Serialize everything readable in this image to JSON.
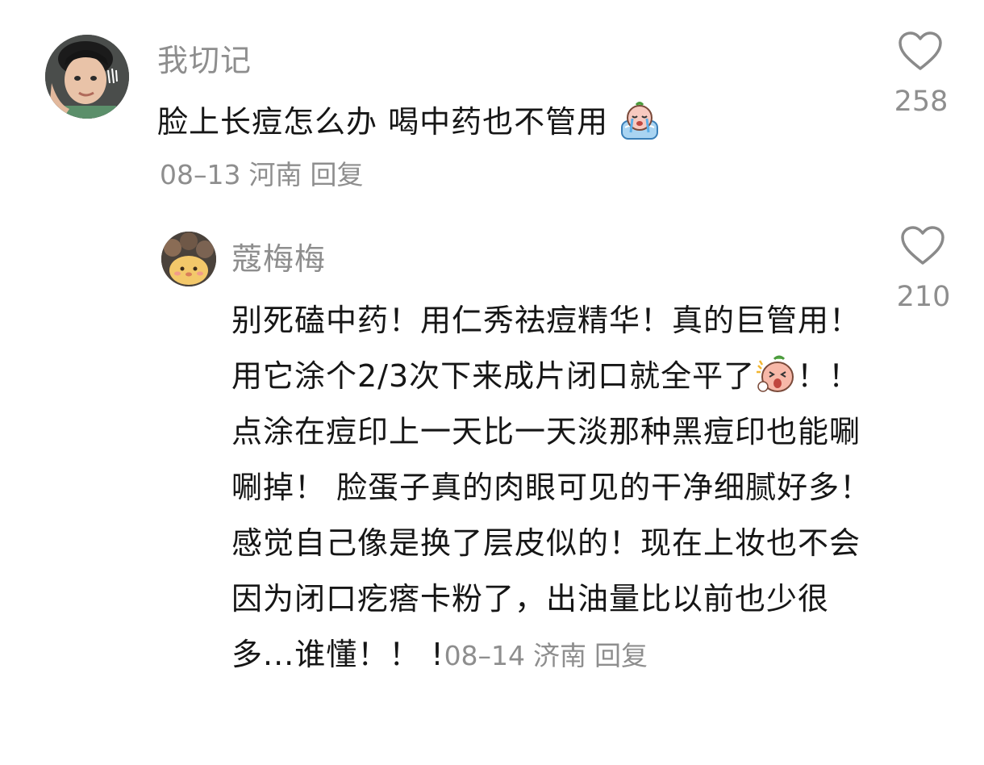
{
  "comments": [
    {
      "username": "我切记",
      "text": "脸上长痘怎么办 喝中药也不管用",
      "sticker": "crying-sticker",
      "date": "08–13",
      "location": "河南",
      "reply_label": "回复",
      "likes": "258"
    },
    {
      "username": "蔻梅梅",
      "text_parts": [
        "别死磕中药！用仁秀祛痘精华！真的巨管用！用它涂个2/3次下来成片闭口就全平了",
        "！！ 点涂在痘印上一天比一天淡那种黑痘印也能唰唰掉！ 脸蛋子真的肉眼可见的干净细腻好多！感觉自己像是换了层皮似的！现在上妆也不会因为闭口疙瘩卡粉了，出油量比以前也少很多...谁懂！！ !"
      ],
      "sticker": "excited-sticker",
      "date": "08–14",
      "location": "济南",
      "reply_label": "回复",
      "likes": "210"
    }
  ]
}
